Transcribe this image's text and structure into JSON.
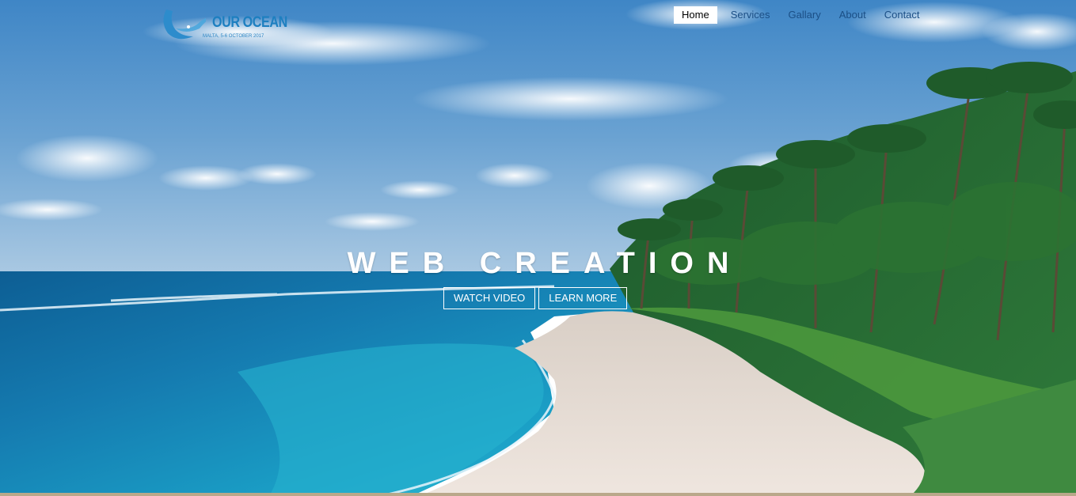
{
  "logo": {
    "title": "OUR OCEAN",
    "subtitle": "MALTA, 5-6 OCTOBER 2017"
  },
  "nav": {
    "items": [
      {
        "label": "Home",
        "active": true
      },
      {
        "label": "Services",
        "active": false
      },
      {
        "label": "Gallary",
        "active": false
      },
      {
        "label": "About",
        "active": false
      },
      {
        "label": "Contact",
        "active": false
      }
    ]
  },
  "hero": {
    "headline": "WEB CREATION",
    "buttons": {
      "watch": "WATCH VIDEO",
      "learn": "LEARN MORE"
    }
  },
  "colors": {
    "nav_text": "#1b4f86",
    "active_bg": "#ffffff",
    "logo_blue": "#1d7fc0"
  }
}
